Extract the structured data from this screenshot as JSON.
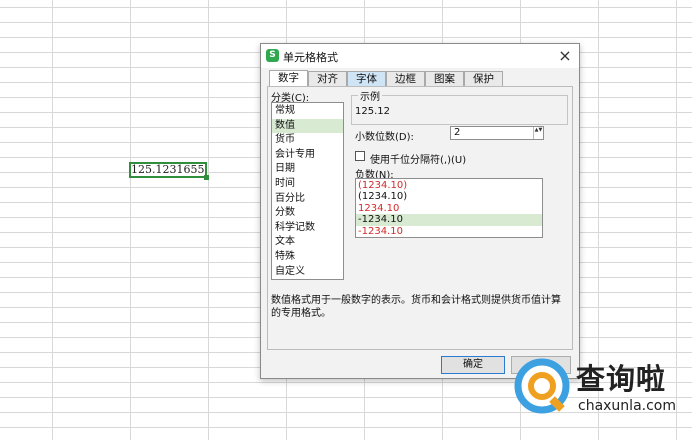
{
  "sheet": {
    "active_cell_value": "125.1231655"
  },
  "dialog": {
    "app_icon_letter": "S",
    "title": "单元格格式",
    "close_label": "×",
    "tabs": [
      {
        "label": "数字"
      },
      {
        "label": "对齐"
      },
      {
        "label": "字体"
      },
      {
        "label": "边框"
      },
      {
        "label": "图案"
      },
      {
        "label": "保护"
      }
    ],
    "category_label": "分类(C):",
    "categories": [
      {
        "label": "常规"
      },
      {
        "label": "数值"
      },
      {
        "label": "货币"
      },
      {
        "label": "会计专用"
      },
      {
        "label": "日期"
      },
      {
        "label": "时间"
      },
      {
        "label": "百分比"
      },
      {
        "label": "分数"
      },
      {
        "label": "科学记数"
      },
      {
        "label": "文本"
      },
      {
        "label": "特殊"
      },
      {
        "label": "自定义"
      }
    ],
    "selected_category": "数值",
    "sample": {
      "legend": "示例",
      "value": "125.12"
    },
    "decimal_places": {
      "label": "小数位数(D):",
      "value": "2",
      "arrows": "▲▼"
    },
    "thousands_separator": {
      "label": "使用千位分隔符(,)(U)",
      "checked": false
    },
    "negative_numbers": {
      "label": "负数(N):",
      "options": [
        {
          "text": "(1234.10)",
          "color": "#d22a2a"
        },
        {
          "text": "(1234.10)",
          "color": "#111111"
        },
        {
          "text": "1234.10",
          "color": "#d22a2a"
        },
        {
          "text": "-1234.10",
          "color": "#111111"
        },
        {
          "text": "-1234.10",
          "color": "#d22a2a"
        }
      ],
      "selected_index": 3
    },
    "description": "数值格式用于一般数字的表示。货币和会计格式则提供货币值计算的专用格式。",
    "ok_label": "确定",
    "cancel_label": ""
  },
  "watermark": {
    "text": "查询啦",
    "url": "chaxunla.com"
  },
  "colors": {
    "accent_green": "#2f8f3c",
    "selection_green": "#d9ead3",
    "negative_red": "#d22a2a"
  }
}
